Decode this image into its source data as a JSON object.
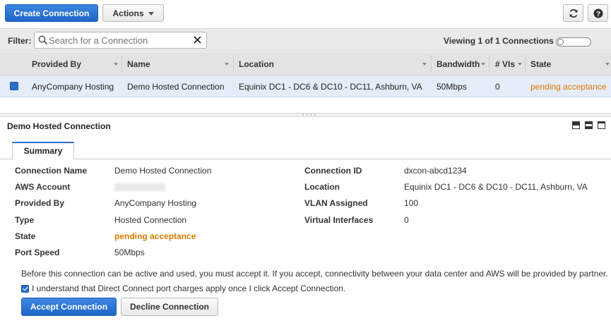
{
  "toolbar": {
    "create_label": "Create Connection",
    "actions_label": "Actions",
    "refresh_icon": "refresh-icon",
    "help_icon": "help-icon"
  },
  "filter": {
    "label": "Filter:",
    "placeholder": "Search for a Connection",
    "viewing": "Viewing 1 of 1 Connections"
  },
  "table": {
    "columns": [
      "Provided By",
      "Name",
      "Location",
      "Bandwidth",
      "# VIs",
      "State"
    ],
    "rows": [
      {
        "provided_by": "AnyCompany Hosting",
        "name": "Demo Hosted Connection",
        "location": "Equinix DC1 - DC6 & DC10 - DC11, Ashburn, VA",
        "bandwidth": "50Mbps",
        "vis": "0",
        "state": "pending acceptance"
      }
    ]
  },
  "detail": {
    "title": "Demo Hosted Connection",
    "tab": "Summary",
    "left": [
      {
        "key": "Connection Name",
        "value": "Demo Hosted Connection"
      },
      {
        "key": "AWS Account",
        "value": ""
      },
      {
        "key": "Provided By",
        "value": "AnyCompany Hosting"
      },
      {
        "key": "Type",
        "value": "Hosted Connection"
      },
      {
        "key": "State",
        "value": "pending acceptance"
      },
      {
        "key": "Port Speed",
        "value": "50Mbps"
      }
    ],
    "right": [
      {
        "key": "Connection ID",
        "value": "dxcon-abcd1234"
      },
      {
        "key": "Location",
        "value": "Equinix DC1 - DC6 & DC10 - DC11, Ashburn, VA"
      },
      {
        "key": "VLAN Assigned",
        "value": "100"
      },
      {
        "key": "Virtual Interfaces",
        "value": "0"
      }
    ],
    "notice": "Before this connection can be active and used, you must accept it. If you accept, connectivity between your data center and AWS will be provided by partner.",
    "agree": "I understand that Direct Connect port charges apply once I click Accept Connection.",
    "accept_label": "Accept Connection",
    "decline_label": "Decline Connection"
  },
  "colors": {
    "primary": "#2a6fd0",
    "state_pending": "#dd7a00",
    "row_selected": "#e4ecf7"
  }
}
